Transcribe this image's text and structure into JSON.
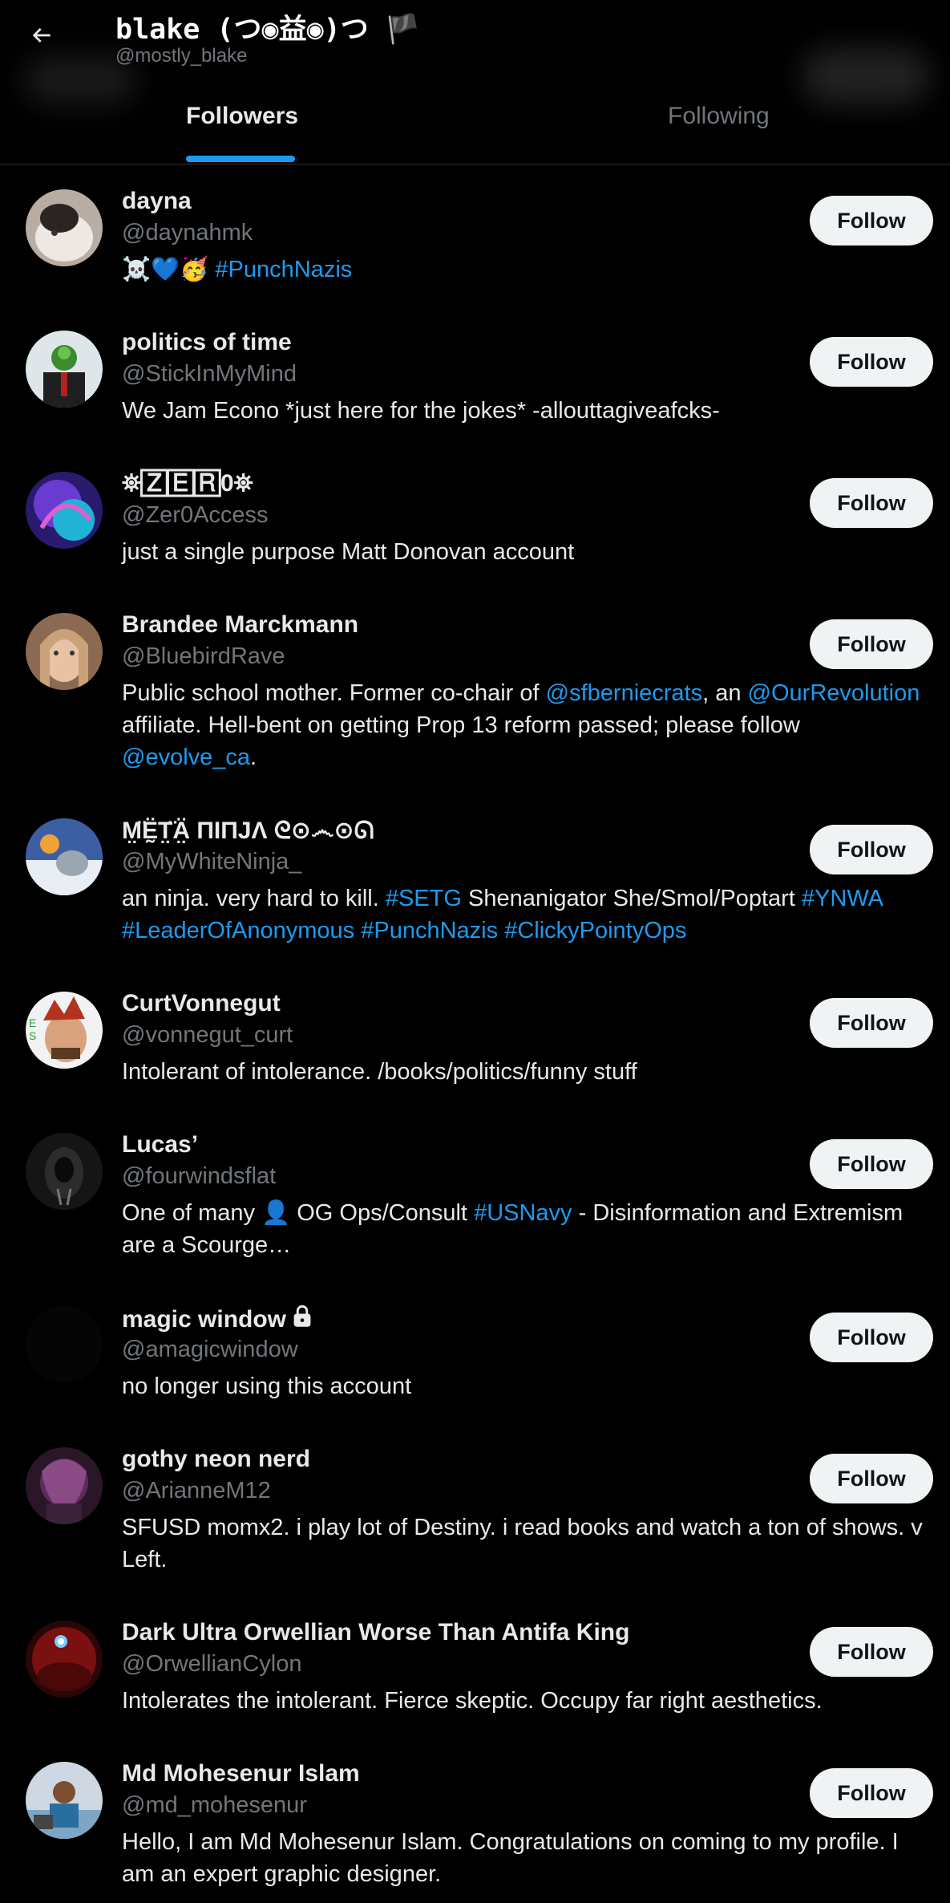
{
  "profile": {
    "name": "blake (つ◉益◉)つ 🏴",
    "handle": "@mostly_blake"
  },
  "tabs": [
    {
      "label": "Followers",
      "active": true
    },
    {
      "label": "Following",
      "active": false
    }
  ],
  "follow_label": "Follow",
  "colors": {
    "accent": "#1d9bf0",
    "background": "#000000",
    "muted": "#71767b",
    "button": "#eff3f4"
  },
  "followers": [
    {
      "name": "dayna",
      "handle": "@daynahmk",
      "bio": [
        {
          "t": "☠️💙🥳 "
        },
        {
          "t": "#PunchNazis",
          "link": true
        }
      ]
    },
    {
      "name": "politics of time",
      "handle": "@StickInMyMind",
      "bio": [
        {
          "t": "We Jam Econo *just here for the jokes* -allouttagiveafcks-"
        }
      ]
    },
    {
      "name": "⛯🅉🄴🅁0⛯",
      "handle": "@Zer0Access",
      "bio": [
        {
          "t": "just a single purpose Matt Donovan account"
        }
      ]
    },
    {
      "name": "Brandee Marckmann",
      "handle": "@BluebirdRave",
      "bio": [
        {
          "t": "Public school mother. Former co-chair of "
        },
        {
          "t": "@sfberniecrats",
          "link": true
        },
        {
          "t": ", an "
        },
        {
          "t": "@OurRevolution",
          "link": true
        },
        {
          "t": " affiliate. Hell-bent on getting Prop 13 reform passed; please follow "
        },
        {
          "t": "@evolve_ca",
          "link": true
        },
        {
          "t": "."
        }
      ]
    },
    {
      "name": "M̤̈Ḛ̈T̤̈Ä̤ ПIПJΛ ᘓ⊙෴⊙ᘏ",
      "handle": "@MyWhiteNinja_",
      "bio": [
        {
          "t": "an ninja. very hard to kill. "
        },
        {
          "t": "#SETG",
          "link": true
        },
        {
          "t": " Shenanigator She/Smol/Poptart "
        },
        {
          "t": "#YNWA",
          "link": true
        },
        {
          "t": " "
        },
        {
          "t": "#LeaderOfAnonymous",
          "link": true
        },
        {
          "t": " "
        },
        {
          "t": "#PunchNazis",
          "link": true
        },
        {
          "t": " "
        },
        {
          "t": "#ClickyPointyOps",
          "link": true
        }
      ]
    },
    {
      "name": "CurtVonnegut",
      "handle": "@vonnegut_curt",
      "bio": [
        {
          "t": "Intolerant of intolerance. /books/politics/funny stuff"
        }
      ]
    },
    {
      "name": "Lucas’",
      "handle": "@fourwindsflat",
      "bio": [
        {
          "t": "One of many 👤 OG Ops/Consult "
        },
        {
          "t": "#USNavy",
          "link": true
        },
        {
          "t": " - Disinformation and Extremism are a Scourge…"
        }
      ]
    },
    {
      "name": "magic window",
      "handle": "@amagicwindow",
      "locked": true,
      "bio": [
        {
          "t": "no longer using this account"
        }
      ]
    },
    {
      "name": "gothy neon nerd",
      "handle": "@ArianneM12",
      "bio": [
        {
          "t": "SFUSD momx2. i play lot of Destiny. i read books and watch a ton of shows. v Left."
        }
      ]
    },
    {
      "name": "Dark Ultra Orwellian Worse Than Antifa King",
      "handle": "@OrwellianCylon",
      "bio": [
        {
          "t": "Intolerates the intolerant. Fierce skeptic. Occupy far right aesthetics."
        }
      ]
    },
    {
      "name": "Md Mohesenur Islam",
      "handle": "@md_mohesenur",
      "bio": [
        {
          "t": "Hello, I am Md Mohesenur Islam. Congratulations on coming to my profile. I am an expert graphic designer."
        }
      ]
    }
  ]
}
